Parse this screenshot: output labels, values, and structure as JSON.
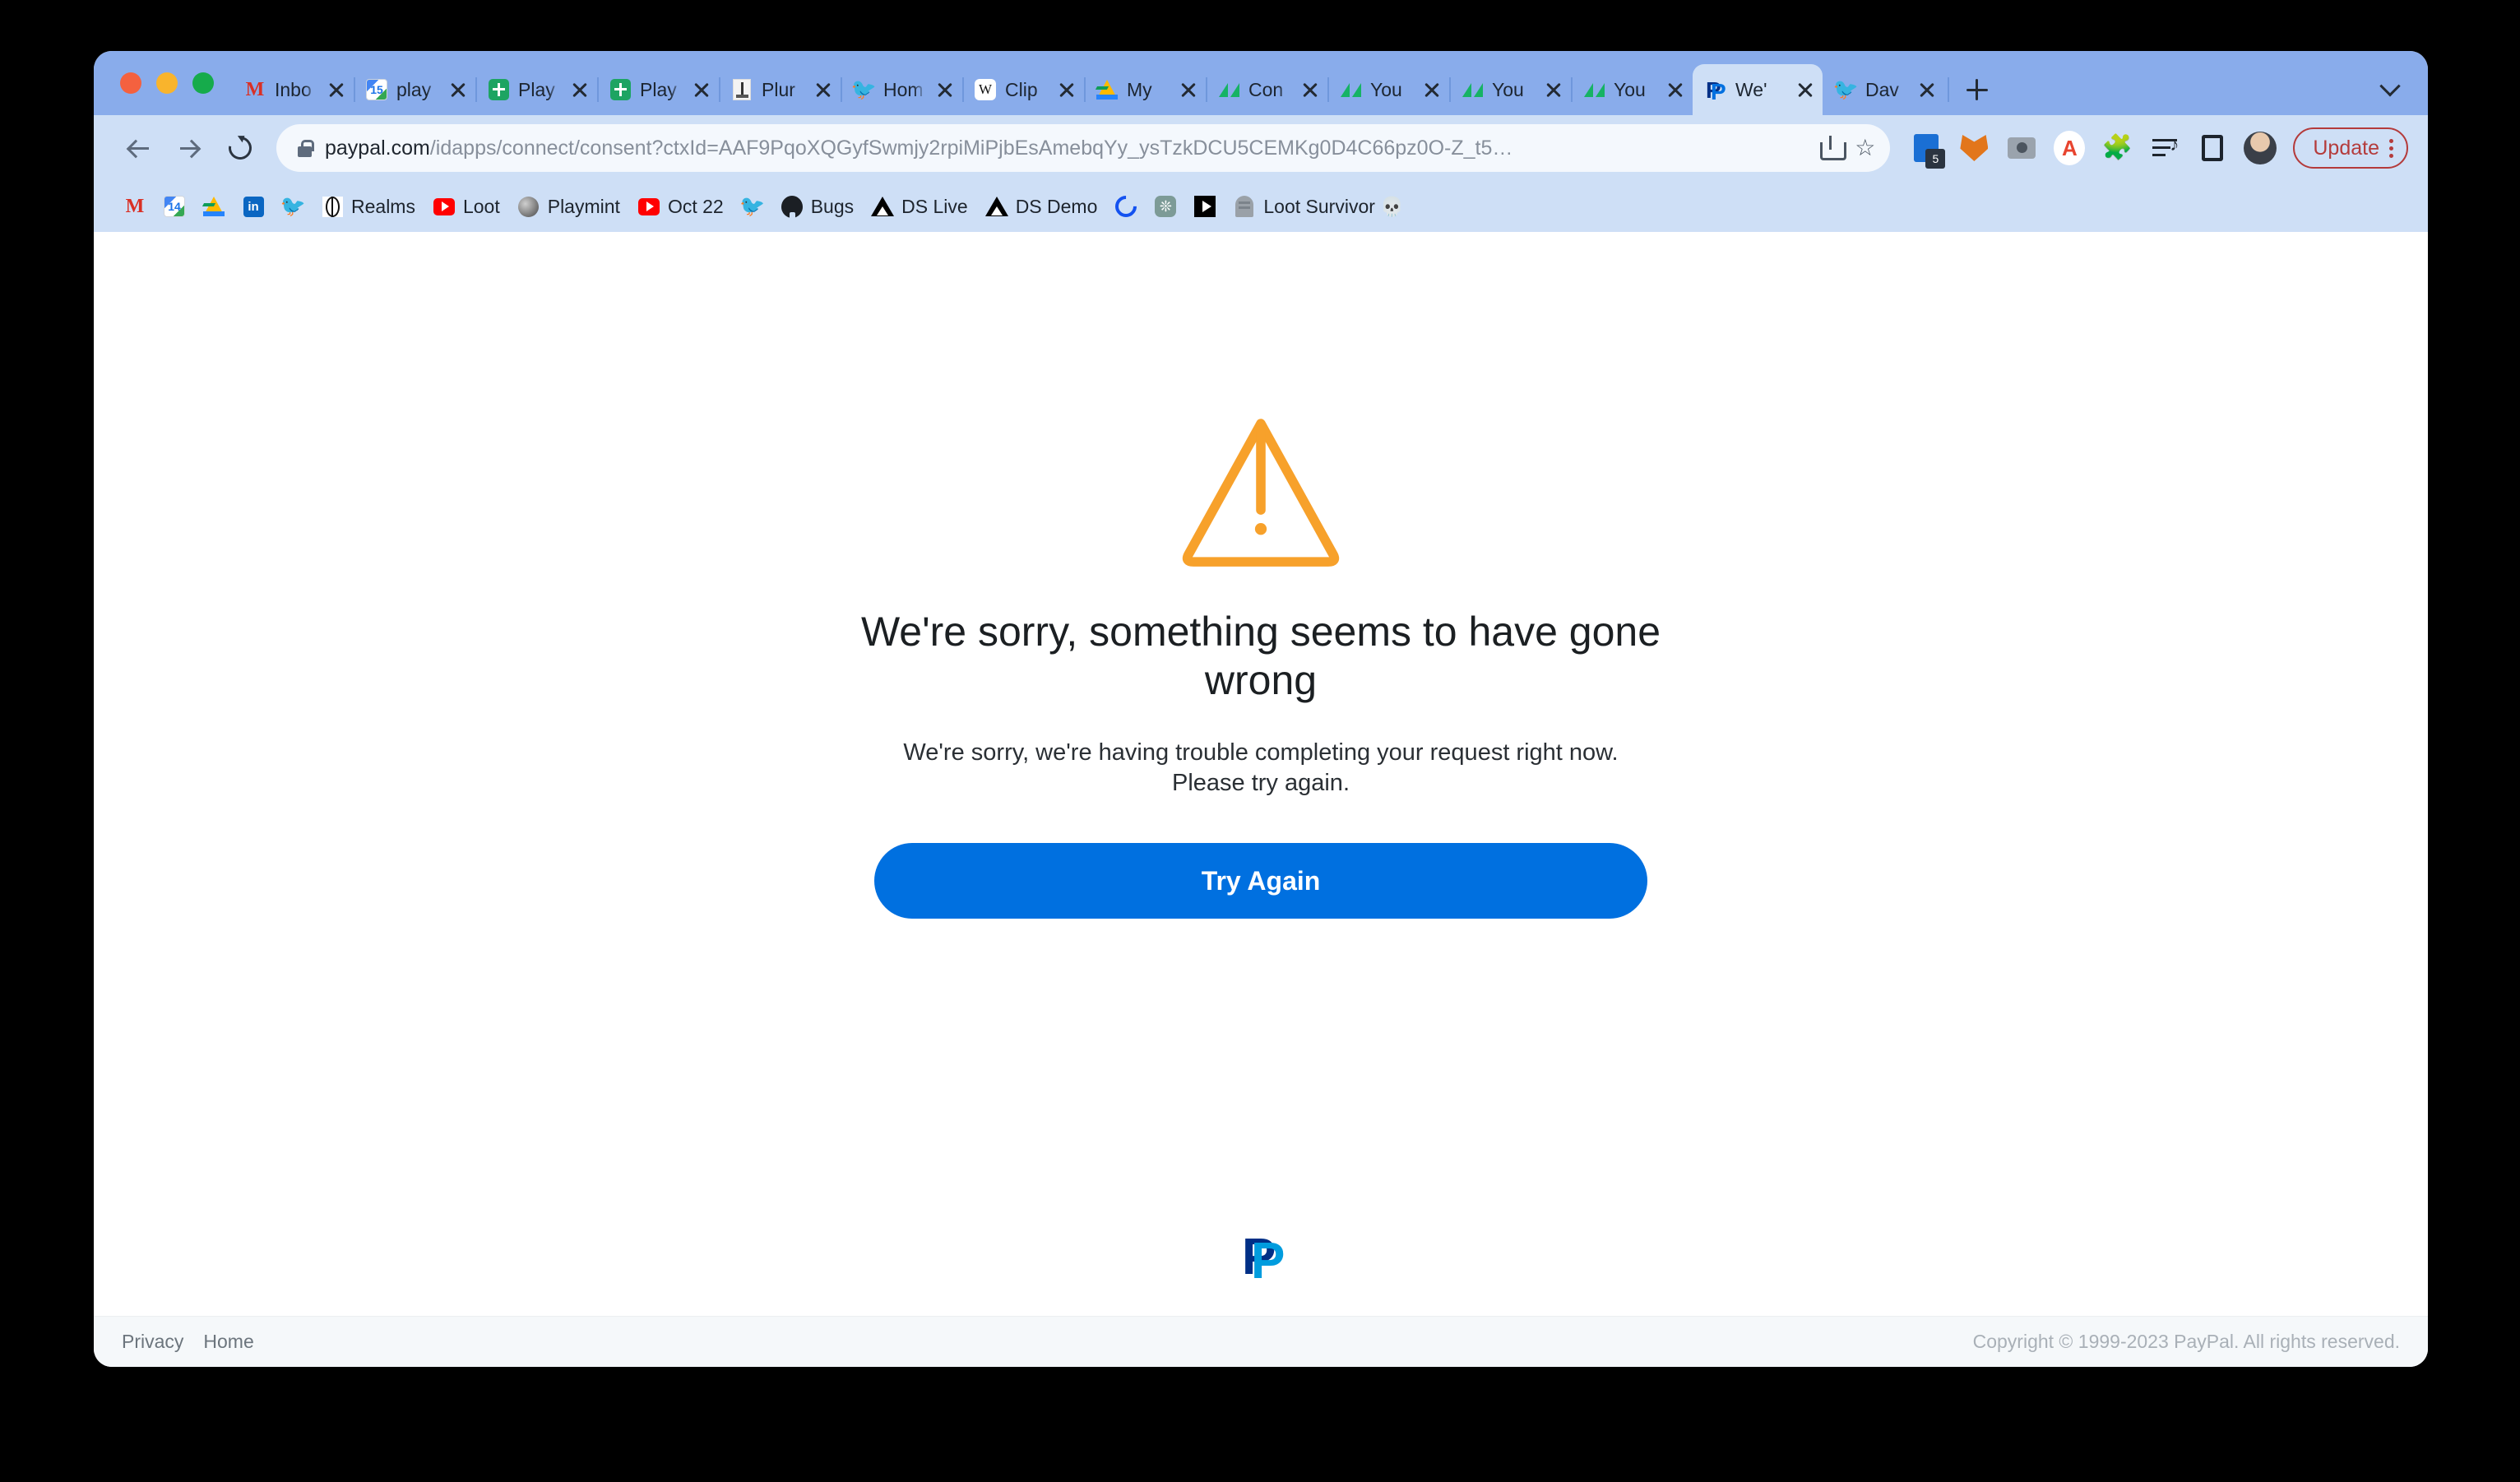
{
  "window": {
    "traffic_lights": [
      "close",
      "minimize",
      "zoom"
    ]
  },
  "browser": {
    "tabs": [
      {
        "title": "Inbo",
        "icon": "gmail-icon",
        "active": false
      },
      {
        "title": "play",
        "icon": "google-calendar-icon",
        "active": false
      },
      {
        "title": "Play",
        "icon": "google-sheets-icon",
        "active": false
      },
      {
        "title": "Play",
        "icon": "google-sheets-icon",
        "active": false
      },
      {
        "title": "Plur",
        "icon": "plur-icon",
        "active": false
      },
      {
        "title": "Hom",
        "icon": "twitter-icon",
        "active": false
      },
      {
        "title": "Clip",
        "icon": "wikipedia-icon",
        "active": false
      },
      {
        "title": "My ",
        "icon": "google-drive-icon",
        "active": false
      },
      {
        "title": "Con",
        "icon": "green-triangles-icon",
        "active": false
      },
      {
        "title": "You",
        "icon": "green-triangles-icon",
        "active": false
      },
      {
        "title": "You",
        "icon": "green-triangles-icon",
        "active": false
      },
      {
        "title": "You",
        "icon": "green-triangles-icon",
        "active": false
      },
      {
        "title": "We'",
        "icon": "paypal-icon",
        "active": true
      },
      {
        "title": "Dav",
        "icon": "twitter-icon",
        "active": false
      }
    ],
    "new_tab_label": "+",
    "tab_overflow_label": "v",
    "toolbar": {
      "back_label": "Back",
      "forward_label": "Forward",
      "reload_label": "Reload",
      "url_domain": "paypal.com",
      "url_path": "/idapps/connect/consent?ctxId=AAF9PqoXQGyfSwmjy2rpiMiPjbEsAmebqYy_ysTzkDCU5CEMKg0D4C66pz0O-Z_t5…",
      "share_label": "Share",
      "bookmark_label": "Bookmark",
      "update_label": "Update",
      "update_color": "#b43b3b",
      "extensions": [
        {
          "name": "reader-extension",
          "badge": "5"
        },
        {
          "name": "metamask-extension",
          "badge": ""
        },
        {
          "name": "screenshot-extension",
          "badge": ""
        },
        {
          "name": "a-extension",
          "badge": "A"
        },
        {
          "name": "puzzle-extensions",
          "badge": ""
        },
        {
          "name": "playlist-extension",
          "badge": ""
        },
        {
          "name": "side-panel",
          "badge": ""
        },
        {
          "name": "profile-avatar",
          "badge": ""
        }
      ]
    },
    "bookmarks": [
      {
        "label": "",
        "icon": "gmail-icon"
      },
      {
        "label": "",
        "icon": "google-calendar-icon",
        "day": "14"
      },
      {
        "label": "",
        "icon": "google-drive-icon"
      },
      {
        "label": "",
        "icon": "linkedin-icon"
      },
      {
        "label": "",
        "icon": "twitter-icon"
      },
      {
        "label": "Realms",
        "icon": "realms-icon"
      },
      {
        "label": "Loot",
        "icon": "youtube-icon"
      },
      {
        "label": "Playmint",
        "icon": "moon-icon"
      },
      {
        "label": "Oct 22",
        "icon": "youtube-icon"
      },
      {
        "label": "",
        "icon": "twitter-icon"
      },
      {
        "label": "Bugs",
        "icon": "github-icon"
      },
      {
        "label": "DS Live",
        "icon": "vercel-icon"
      },
      {
        "label": "DS Demo",
        "icon": "vercel-icon"
      },
      {
        "label": "",
        "icon": "coinbase-icon"
      },
      {
        "label": "",
        "icon": "openai-icon"
      },
      {
        "label": "",
        "icon": "play-icon"
      },
      {
        "label": "Loot Survivor 💀",
        "icon": "tombstone-icon"
      }
    ]
  },
  "page": {
    "warning_icon": "warning-triangle-icon",
    "warning_color": "#f7a12b",
    "title": "We're sorry, something seems to have gone wrong",
    "body": "We're sorry, we're having trouble completing your request right now. Please try again.",
    "button_label": "Try Again",
    "button_color": "#0070e0",
    "brand_logo": "paypal-logo",
    "footer": {
      "privacy_label": "Privacy",
      "home_label": "Home",
      "copyright": "Copyright © 1999-2023 PayPal. All rights reserved."
    }
  }
}
